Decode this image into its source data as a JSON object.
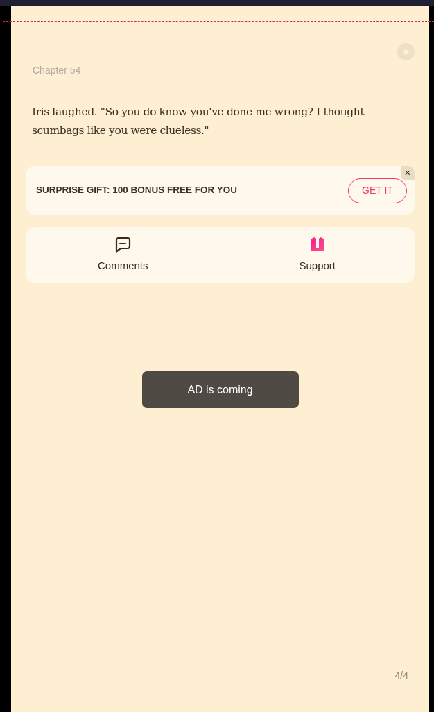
{
  "chapter_title": "Chapter 54",
  "paragraph": "Iris laughed. \"So you do know you've done me wrong? I thought scumbags like you were clueless.\"",
  "gift_banner": {
    "text": "SURPRISE GIFT: 100 BONUS FREE FOR YOU",
    "button": "GET IT",
    "close": "×"
  },
  "actions": [
    {
      "kind": "comments",
      "label": "Comments"
    },
    {
      "kind": "support",
      "label": "Support"
    }
  ],
  "toast": "AD is coming",
  "page_indicator": "4/4"
}
